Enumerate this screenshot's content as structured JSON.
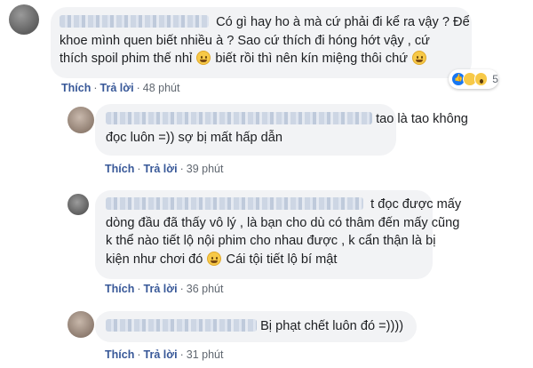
{
  "comments": [
    {
      "lines": [
        "Có gì hay ho à mà cứ phải đi kể ra vậy ? Để",
        "khoe mình quen biết nhiều à ? Sao cứ thích đi hóng hớt vậy , cứ",
        "thích spoil phim thế nhỉ",
        "biết rồi thì nên kín miệng thôi chứ"
      ],
      "reaction_count": "5",
      "like_label": "Thích",
      "reply_label": "Trả lời",
      "time": "48 phút"
    },
    {
      "lines": [
        "tao là tao không",
        "đọc luôn =)) sợ bị mất hấp dẫn"
      ],
      "like_label": "Thích",
      "reply_label": "Trả lời",
      "time": "39 phút"
    },
    {
      "lines": [
        "t đọc được mấy",
        "dòng đầu đã thấy vô lý , là bạn cho dù có thâm đến mấy cũng",
        "k thể nào tiết lộ nội phim cho nhau được , k cẩn thận là bị",
        "kiện như chơi đó",
        "Cái tội tiết lộ bí mật"
      ],
      "like_label": "Thích",
      "reply_label": "Trả lời",
      "time": "36 phút"
    },
    {
      "lines": [
        "Bị phạt chết luôn đó =))))"
      ],
      "like_label": "Thích",
      "reply_label": "Trả lời",
      "time": "31 phút"
    }
  ],
  "separator": "·",
  "icons": {
    "like": "like-reaction-icon",
    "haha": "haha-reaction-icon",
    "wow": "wow-reaction-icon",
    "emoji": "grinning-emoji-icon"
  },
  "colors": {
    "link": "#385898",
    "bubble": "#f2f3f5",
    "like": "#1877f2"
  }
}
